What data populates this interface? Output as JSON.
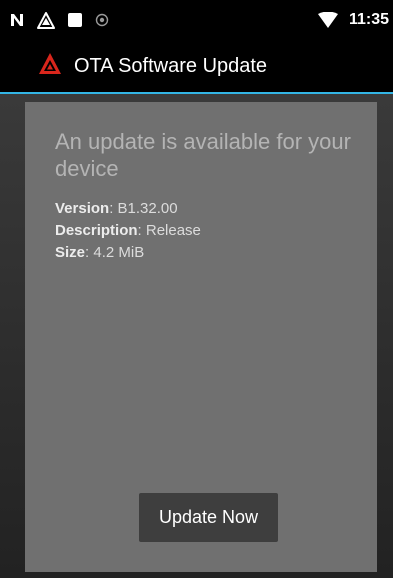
{
  "status_bar": {
    "icons": [
      "n-notification-icon",
      "warning-triangle-icon",
      "square-notification-icon",
      "circle-notification-icon",
      "wifi-icon"
    ],
    "time": "11:35"
  },
  "app_bar": {
    "logo_icon": "red-triangle-logo-icon",
    "title": "OTA Software Update",
    "divider_color": "#33b5e5"
  },
  "update_info": {
    "headline": "An update is available for your device",
    "fields": [
      {
        "label": "Version",
        "value": "B1.32.00"
      },
      {
        "label": "Description",
        "value": "Release"
      },
      {
        "label": "Size",
        "value": "4.2 MiB"
      }
    ]
  },
  "actions": {
    "update_now_label": "Update Now"
  },
  "colors": {
    "card_background": "#707070",
    "accent": "#33b5e5",
    "logo_red": "#d9261c"
  }
}
